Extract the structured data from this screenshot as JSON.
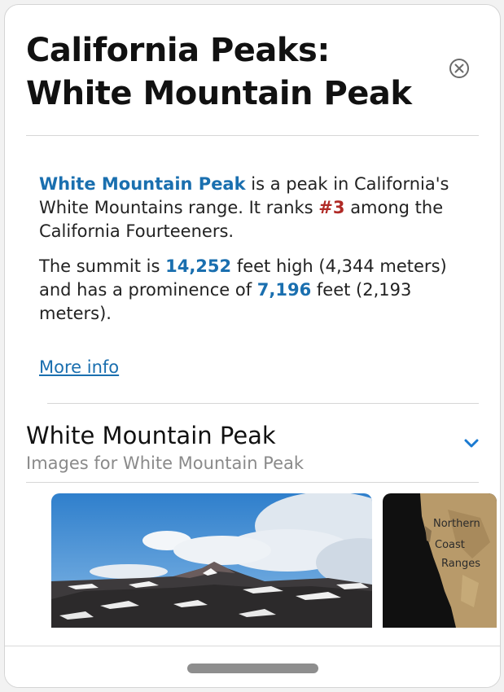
{
  "header": {
    "title": "California Peaks: White Mountain Peak",
    "close_icon": "circle-x-icon"
  },
  "summary": {
    "p1": {
      "peak_name": "White Mountain Peak",
      "text1": " is a peak in California's White Mountains range. It ranks ",
      "rank": "#3",
      "text2": " among the California Fourteeners."
    },
    "p2": {
      "text1": "The summit is ",
      "height_ft": "14,252",
      "text2": " feet high (4,344 meters) and has a prominence of ",
      "prominence_ft": "7,196",
      "text3": " feet (2,193 meters)."
    },
    "more_link": "More info"
  },
  "images_section": {
    "title": "White Mountain Peak",
    "subtitle": "Images for White Mountain Peak",
    "chevron_icon": "chevron-down-icon",
    "map_labels": [
      "Northern",
      "Coast",
      "Ranges"
    ]
  },
  "colors": {
    "accent_blue": "#1a6faf",
    "rank_red": "#b02a26"
  }
}
